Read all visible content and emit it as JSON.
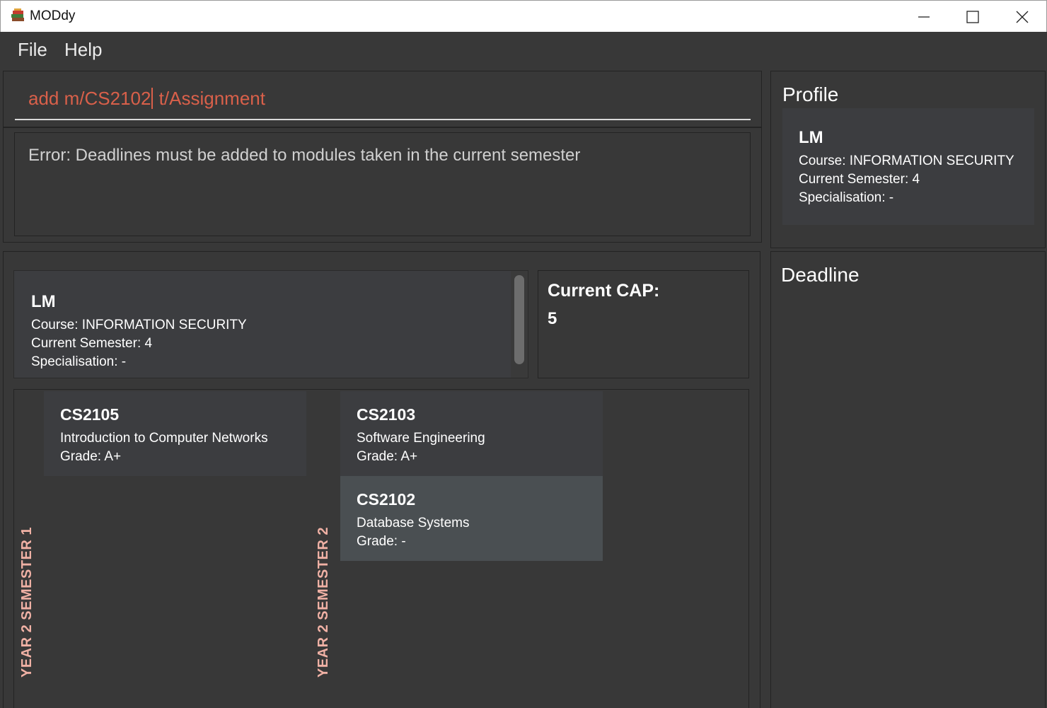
{
  "window": {
    "title": "MODdy"
  },
  "menu": {
    "file": "File",
    "help": "Help"
  },
  "command": {
    "before_caret": "add m/CS2102",
    "after_caret": " t/Assignment"
  },
  "result": {
    "message": "Error: Deadlines must be added to modules taken in the current semester"
  },
  "student": {
    "name": "LM",
    "course": "Course: INFORMATION SECURITY",
    "semester": "Current Semester: 4",
    "specialisation": "Specialisation: -"
  },
  "cap": {
    "label": "Current CAP:",
    "value": "5"
  },
  "semesters": [
    {
      "label": "YEAR 2 SEMESTER 1",
      "modules": [
        {
          "code": "CS2105",
          "title": "Introduction to Computer Networks",
          "grade": "Grade: A+"
        }
      ]
    },
    {
      "label": "YEAR 2 SEMESTER 2",
      "modules": [
        {
          "code": "CS2103",
          "title": "Software Engineering",
          "grade": "Grade: A+"
        },
        {
          "code": "CS2102",
          "title": "Database Systems",
          "grade": "Grade: -"
        }
      ]
    }
  ],
  "side": {
    "profile_title": "Profile",
    "deadline_title": "Deadline"
  },
  "colors": {
    "background": "#383838",
    "card": "#3c3d40",
    "selected_card": "#4a4f52",
    "command_text": "#d9604a",
    "semester_label": "#f0b1a5"
  }
}
